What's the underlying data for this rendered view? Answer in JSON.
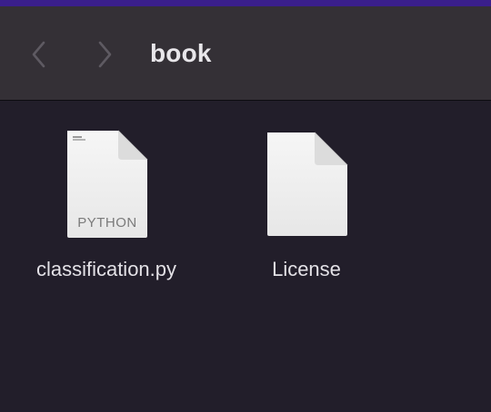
{
  "window": {
    "title": "book"
  },
  "toolbar": {
    "back_icon": "chevron-left-icon",
    "forward_icon": "chevron-right-icon"
  },
  "files": [
    {
      "name": "classification.py",
      "icon": "python-file-icon",
      "badge": "PYTHON"
    },
    {
      "name": "License",
      "icon": "blank-document-icon"
    }
  ],
  "colors": {
    "background": "#221e2a",
    "toolbar": "#343036",
    "accent_strip": "#3a1f8c",
    "text": "#e3e1e6"
  }
}
